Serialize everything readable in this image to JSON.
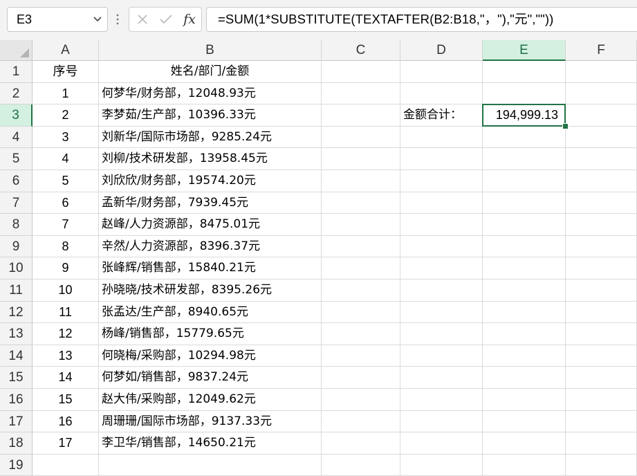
{
  "formula_bar": {
    "name_box": "E3",
    "formula": "=SUM(1*SUBSTITUTE(TEXTAFTER(B2:B18,\"，\"),\"元\",\"\"))",
    "fx_label": "fx"
  },
  "columns": [
    "A",
    "B",
    "C",
    "D",
    "E",
    "F"
  ],
  "active_cell": {
    "column": "E",
    "row": 3
  },
  "rows": [
    {
      "num": "1",
      "a": "序号",
      "b": "姓名/部门/金额",
      "d": "",
      "e": ""
    },
    {
      "num": "2",
      "a": "1",
      "b": "何梦华/财务部，12048.93元",
      "d": "",
      "e": ""
    },
    {
      "num": "3",
      "a": "2",
      "b": "李梦茹/生产部，10396.33元",
      "d": "金额合计：",
      "e": "194,999.13"
    },
    {
      "num": "4",
      "a": "3",
      "b": "刘新华/国际市场部，9285.24元",
      "d": "",
      "e": ""
    },
    {
      "num": "5",
      "a": "4",
      "b": "刘柳/技术研发部，13958.45元",
      "d": "",
      "e": ""
    },
    {
      "num": "6",
      "a": "5",
      "b": "刘欣欣/财务部，19574.20元",
      "d": "",
      "e": ""
    },
    {
      "num": "7",
      "a": "6",
      "b": "孟新华/财务部，7939.45元",
      "d": "",
      "e": ""
    },
    {
      "num": "8",
      "a": "7",
      "b": "赵峰/人力资源部，8475.01元",
      "d": "",
      "e": ""
    },
    {
      "num": "9",
      "a": "8",
      "b": "辛然/人力资源部，8396.37元",
      "d": "",
      "e": ""
    },
    {
      "num": "10",
      "a": "9",
      "b": "张峰辉/销售部，15840.21元",
      "d": "",
      "e": ""
    },
    {
      "num": "11",
      "a": "10",
      "b": "孙晓晓/技术研发部，8395.26元",
      "d": "",
      "e": ""
    },
    {
      "num": "12",
      "a": "11",
      "b": "张孟达/生产部，8940.65元",
      "d": "",
      "e": ""
    },
    {
      "num": "13",
      "a": "12",
      "b": "杨峰/销售部，15779.65元",
      "d": "",
      "e": ""
    },
    {
      "num": "14",
      "a": "13",
      "b": "何晓梅/采购部，10294.98元",
      "d": "",
      "e": ""
    },
    {
      "num": "15",
      "a": "14",
      "b": "何梦如/销售部，9837.24元",
      "d": "",
      "e": ""
    },
    {
      "num": "16",
      "a": "15",
      "b": "赵大伟/采购部，12049.62元",
      "d": "",
      "e": ""
    },
    {
      "num": "17",
      "a": "16",
      "b": "周珊珊/国际市场部，9137.33元",
      "d": "",
      "e": ""
    },
    {
      "num": "18",
      "a": "17",
      "b": "李卫华/销售部，14650.21元",
      "d": "",
      "e": ""
    },
    {
      "num": "19",
      "a": "",
      "b": "",
      "d": "",
      "e": ""
    }
  ],
  "colors": {
    "accent": "#217346",
    "header_active_bg": "#d3f0e0",
    "gridline": "#dadada"
  },
  "icons": {
    "cancel": "close-icon",
    "enter": "check-icon",
    "name_box_dropdown": "chevron-down-icon",
    "more": "vertical-dots-icon"
  }
}
